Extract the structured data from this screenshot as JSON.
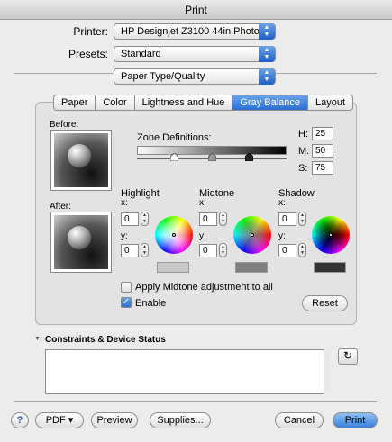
{
  "window": {
    "title": "Print"
  },
  "printer": {
    "label": "Printer:",
    "value": "HP Designjet Z3100 44in Photo"
  },
  "presets": {
    "label": "Presets:",
    "value": "Standard"
  },
  "pane": {
    "value": "Paper Type/Quality"
  },
  "tabs": [
    {
      "label": "Paper"
    },
    {
      "label": "Color"
    },
    {
      "label": "Lightness and Hue"
    },
    {
      "label": "Gray Balance",
      "selected": true
    },
    {
      "label": "Layout"
    }
  ],
  "preview": {
    "before_label": "Before:",
    "after_label": "After:"
  },
  "zones": {
    "label": "Zone Definitions:",
    "h_label": "H:",
    "h_value": "25",
    "m_label": "M:",
    "m_value": "50",
    "s_label": "S:",
    "s_value": "75"
  },
  "balance": {
    "highlight": {
      "label": "Highlight",
      "x_label": "x:",
      "x_value": "0",
      "y_label": "y:",
      "y_value": "0",
      "swatch_color": "#c8c8c8"
    },
    "midtone": {
      "label": "Midtone",
      "x_label": "x:",
      "x_value": "0",
      "y_label": "y:",
      "y_value": "0",
      "swatch_color": "#7f7f7f"
    },
    "shadow": {
      "label": "Shadow",
      "x_label": "x:",
      "x_value": "0",
      "y_label": "y:",
      "y_value": "0",
      "swatch_color": "#333333"
    }
  },
  "options": {
    "apply_midtone_label": "Apply Midtone adjustment to all",
    "apply_midtone_checked": false,
    "enable_label": "Enable",
    "enable_checked": true,
    "reset_label": "Reset"
  },
  "constraints": {
    "label": "Constraints & Device Status",
    "text": ""
  },
  "footer": {
    "help_label": "?",
    "pdf_label": "PDF ▾",
    "preview_label": "Preview",
    "supplies_label": "Supplies...",
    "cancel_label": "Cancel",
    "print_label": "Print"
  },
  "colors": {
    "accent": "#3c80dc",
    "window_bg": "#ececec"
  }
}
